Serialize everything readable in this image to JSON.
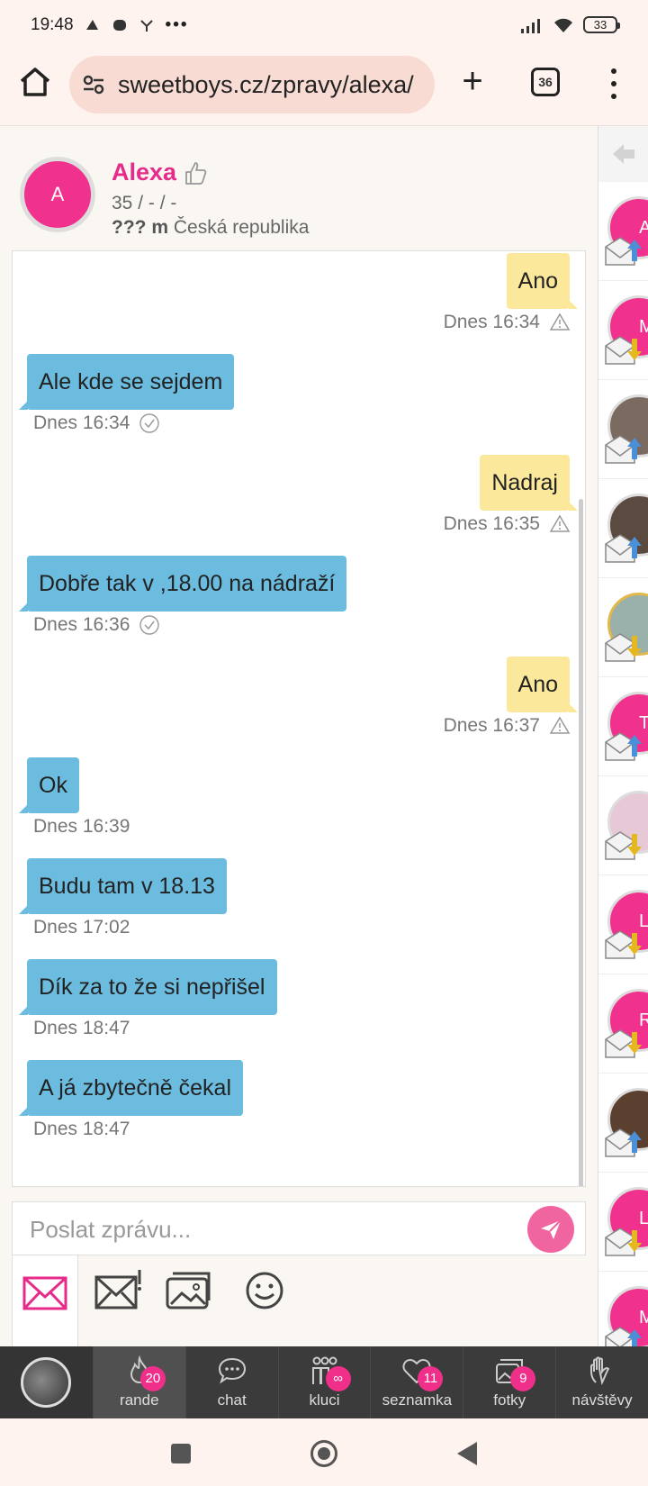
{
  "status": {
    "time": "19:48",
    "battery": "33"
  },
  "browser": {
    "url": "sweetboys.cz/zpravy/alexa/",
    "tab_count": "36"
  },
  "profile": {
    "avatar_letter": "A",
    "name": "Alexa",
    "line1": "35 /  -  /  -",
    "height": "??? m",
    "country": "Česká republika"
  },
  "messages": [
    {
      "dir": "out",
      "text": "Ano",
      "time": "Dnes 16:34",
      "status": "warning"
    },
    {
      "dir": "in",
      "text": "Ale kde se sejdem",
      "time": "Dnes 16:34",
      "status": "read"
    },
    {
      "dir": "out",
      "text": "Nadraj",
      "time": "Dnes 16:35",
      "status": "warning"
    },
    {
      "dir": "in",
      "text": "Dobře tak v ,18.00 na nádraží",
      "time": "Dnes 16:36",
      "status": "read"
    },
    {
      "dir": "out",
      "text": "Ano",
      "time": "Dnes 16:37",
      "status": "warning"
    },
    {
      "dir": "in",
      "text": "Ok",
      "time": "Dnes 16:39",
      "status": ""
    },
    {
      "dir": "in",
      "text": "Budu tam v 18.13",
      "time": "Dnes 17:02",
      "status": ""
    },
    {
      "dir": "in",
      "text": "Dík za to že si nepřišel",
      "time": "Dnes 18:47",
      "status": ""
    },
    {
      "dir": "in",
      "text": "A já zbytečně čekal",
      "time": "Dnes 18:47",
      "status": ""
    }
  ],
  "composer": {
    "placeholder": "Poslat zprávu..."
  },
  "rail": [
    {
      "letter": "A",
      "color": "#f0318e",
      "arrow": "up"
    },
    {
      "letter": "M",
      "color": "#f0318e",
      "arrow": "down"
    },
    {
      "letter": "",
      "color": "#7a6a60",
      "arrow": "up"
    },
    {
      "letter": "",
      "color": "#5a4a40",
      "arrow": "up"
    },
    {
      "letter": "",
      "color": "#9ab0aa",
      "arrow": "down"
    },
    {
      "letter": "T",
      "color": "#f0318e",
      "arrow": "up"
    },
    {
      "letter": "",
      "color": "#e6c8d6",
      "arrow": "down"
    },
    {
      "letter": "L",
      "color": "#f0318e",
      "arrow": "down"
    },
    {
      "letter": "R",
      "color": "#f0318e",
      "arrow": "down"
    },
    {
      "letter": "",
      "color": "#5b4030",
      "arrow": "up"
    },
    {
      "letter": "L",
      "color": "#f0318e",
      "arrow": "down"
    },
    {
      "letter": "M",
      "color": "#f0318e",
      "arrow": "up"
    }
  ],
  "nav": [
    {
      "key": "rande",
      "label": "rande",
      "badge": "20",
      "icon": "flame-icon"
    },
    {
      "key": "chat",
      "label": "chat",
      "badge": "",
      "icon": "chat-icon"
    },
    {
      "key": "kluci",
      "label": "kluci",
      "badge": "∞",
      "icon": "people-icon"
    },
    {
      "key": "seznamka",
      "label": "seznamka",
      "badge": "11",
      "icon": "heart-icon"
    },
    {
      "key": "fotky",
      "label": "fotky",
      "badge": "9",
      "icon": "photos-icon"
    },
    {
      "key": "navstevy",
      "label": "návštěvy",
      "badge": "",
      "icon": "hand-icon"
    }
  ],
  "colors": {
    "accent": "#e62b8a",
    "incoming": "#6bbcdf",
    "outgoing": "#fbe89a"
  }
}
